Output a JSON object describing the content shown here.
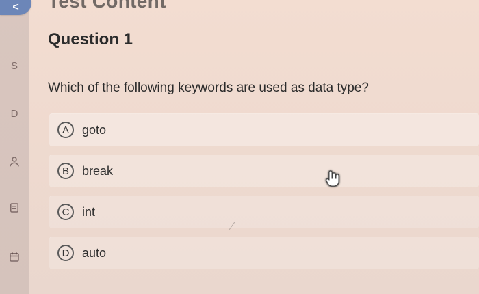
{
  "nav": {
    "back_icon": "chevron-left-icon",
    "back_glyph": "<"
  },
  "header": {
    "section_title": "Test Content"
  },
  "sidebar": {
    "letters": {
      "s": "S",
      "d": "D"
    },
    "icons": [
      "user-icon",
      "document-icon",
      "calendar-icon"
    ]
  },
  "question": {
    "title": "Question 1",
    "prompt": "Which of the following keywords are used as data type?",
    "options": [
      {
        "letter": "A",
        "text": "goto"
      },
      {
        "letter": "B",
        "text": "break"
      },
      {
        "letter": "C",
        "text": "int"
      },
      {
        "letter": "D",
        "text": "auto"
      }
    ]
  },
  "cursor": {
    "icon": "hand-pointer-icon"
  }
}
